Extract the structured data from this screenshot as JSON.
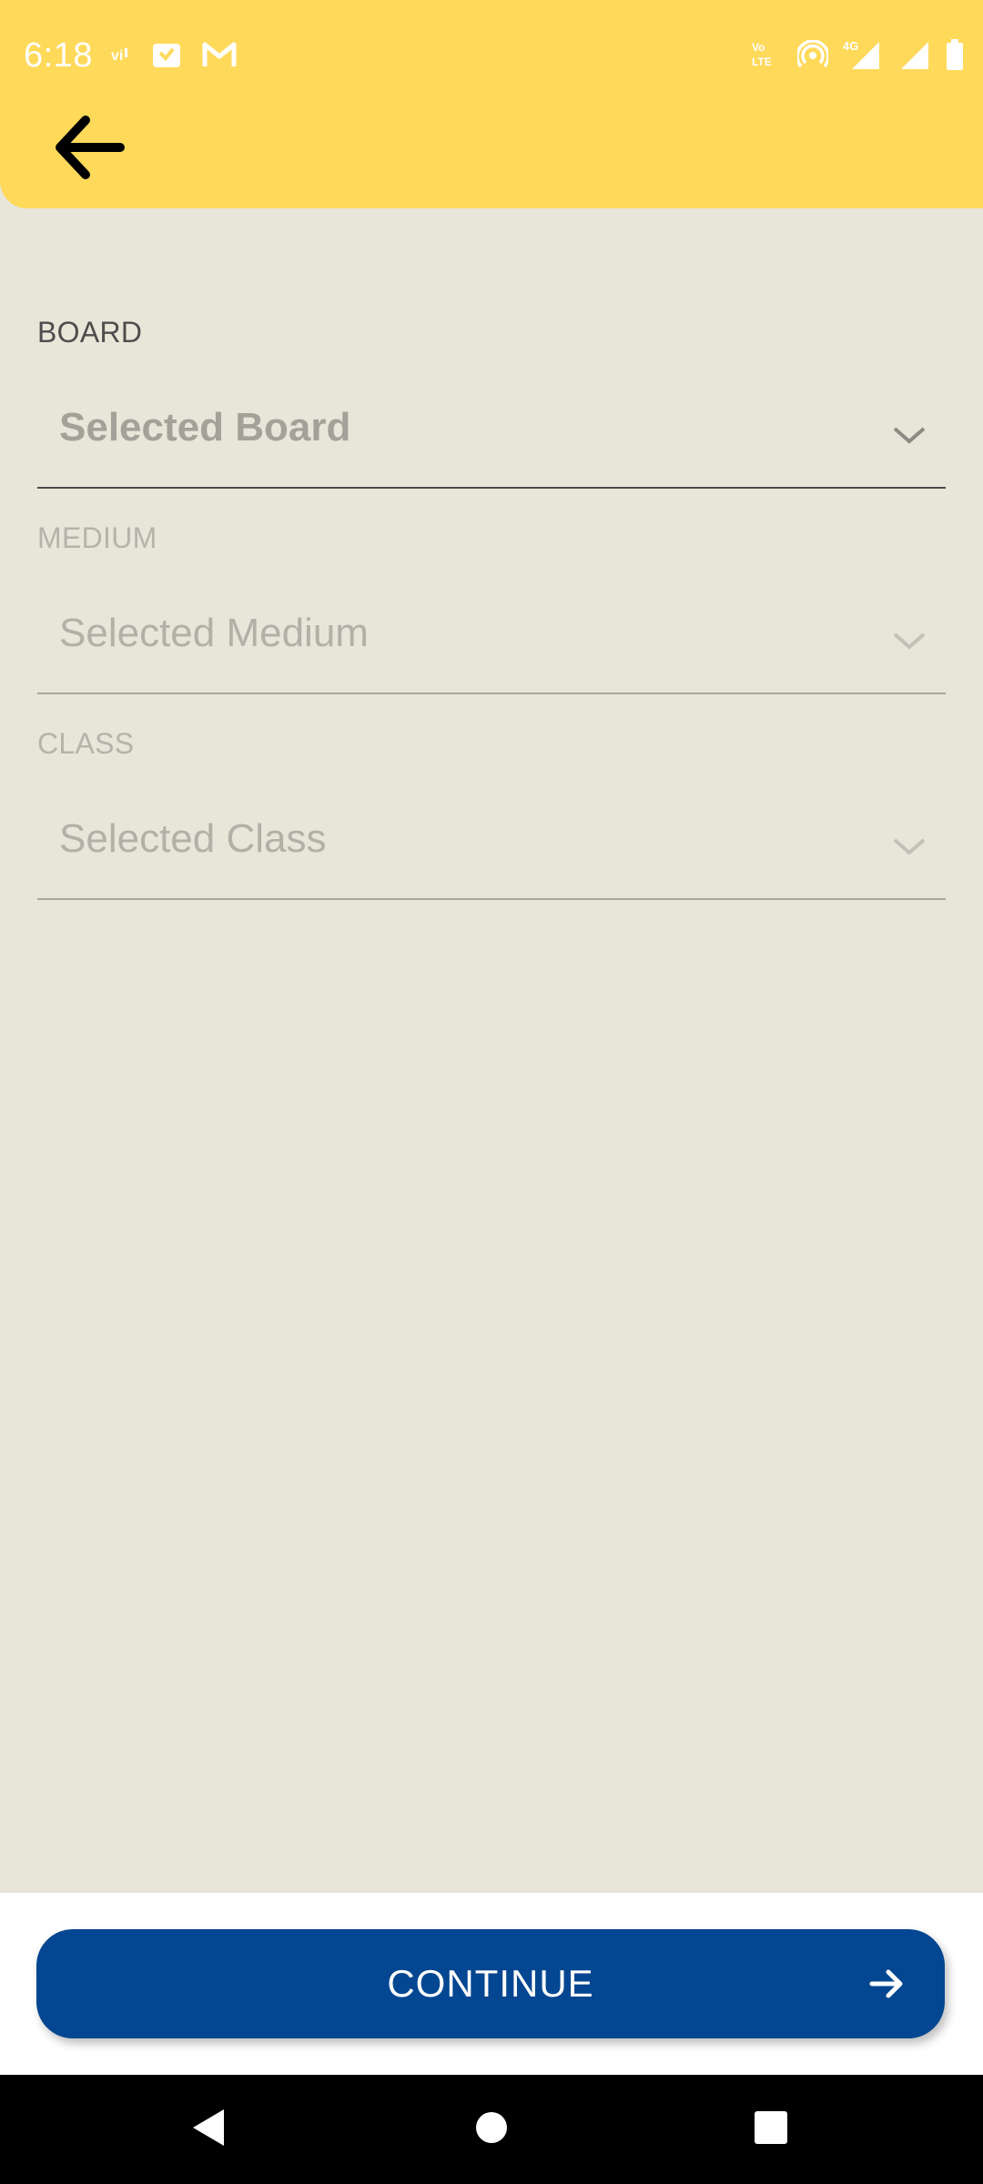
{
  "status_bar": {
    "time": "6:18",
    "left_icons": [
      "vi-carrier-icon",
      "calendar-notification-icon",
      "gmail-icon"
    ],
    "right_icons": [
      "volte-icon",
      "hotspot-icon",
      "4g-signal-icon",
      "signal-icon",
      "battery-icon"
    ],
    "network_label": "4G"
  },
  "header": {
    "back_icon": "arrow-left-icon"
  },
  "form": {
    "board": {
      "label": "BOARD",
      "value": "Selected Board"
    },
    "medium": {
      "label": "MEDIUM",
      "value": "Selected Medium"
    },
    "class": {
      "label": "CLASS",
      "value": "Selected Class"
    }
  },
  "footer": {
    "continue_label": "CONTINUE",
    "continue_icon": "arrow-right-icon"
  },
  "nav_bar": {
    "items": [
      "back-triangle-icon",
      "home-circle-icon",
      "recents-square-icon"
    ]
  },
  "colors": {
    "header_bg": "#ffd95a",
    "page_bg": "#e8e6d9",
    "button_bg": "#034691"
  }
}
